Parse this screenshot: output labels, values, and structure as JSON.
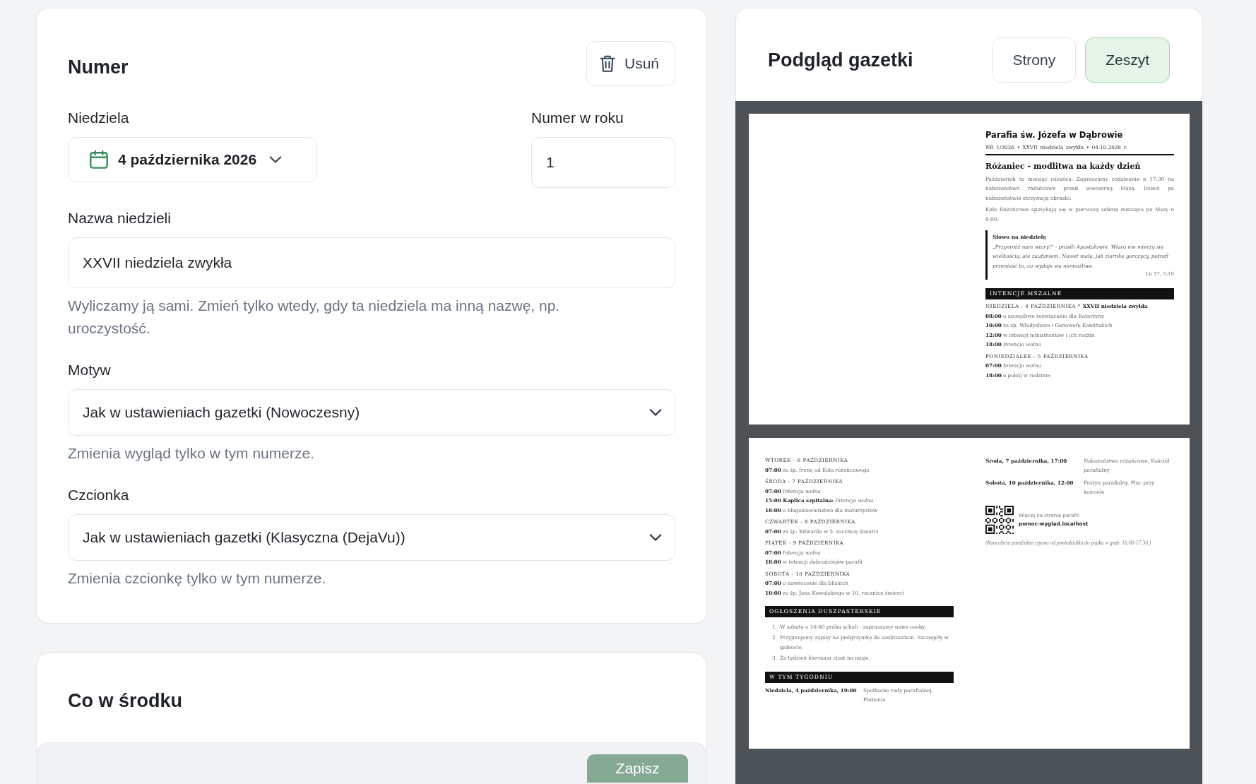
{
  "form": {
    "title": "Numer",
    "delete_button": "Usuń",
    "sunday": {
      "label": "Niedziela",
      "value": "4 października 2026"
    },
    "issue_number": {
      "label": "Numer w roku",
      "value": "1"
    },
    "sunday_name": {
      "label": "Nazwa niedzieli",
      "value": "XXVII niedziela zwykła",
      "hint": "Wyliczamy ją sami. Zmień tylko wtedy, gdy ta niedziela ma inną nazwę, np. uroczystość."
    },
    "theme": {
      "label": "Motyw",
      "value": "Jak w ustawieniach gazetki (Nowoczesny)",
      "hint": "Zmienia wygląd tylko w tym numerze."
    },
    "font": {
      "label": "Czcionka",
      "value": "Jak w ustawieniach gazetki (Klasyczna (DejaVu))",
      "hint": "Zmienia czcionkę tylko w tym numerze."
    }
  },
  "contents": {
    "title": "Co w środku"
  },
  "save_button": "Zapisz",
  "preview": {
    "title": "Podgląd gazetki",
    "modes": [
      {
        "label": "Strony",
        "selected": false
      },
      {
        "label": "Zeszyt",
        "selected": true
      }
    ],
    "sheets": [
      {
        "right": [
          {
            "kind": "masthead",
            "text": "Parafia św. Józefa w Dąbrowie"
          },
          {
            "kind": "meta",
            "text": "NR 1/2026 • XXVII niedziela zwykła • 04.10.2026 r."
          },
          {
            "kind": "heading",
            "text": "Różaniec - modlitwa na każdy dzień"
          },
          {
            "kind": "paragraph",
            "text": "Październik to miesiąc różańca. Zapraszamy codziennie o 17:30 na nabożeństwo różańcowe przed wieczorną Mszą. Dzieci po nabożeństwie otrzymają obrazki."
          },
          {
            "kind": "paragraph",
            "text": "Koła Różańcowe spotykają się w pierwszą sobotę miesiąca po Mszy o 8:00."
          },
          {
            "kind": "quote",
            "title": "Słowo na niedzielę",
            "text": "„Przymnóż nam wiary!” - prosili Apostołowie. Wiara nie mierzy się wielkością, ale zaufaniem. Nawet mała, jak ziarnko gorczycy, potrafi przenieść to, co wydaje się niemożliwe.",
            "source": "Łk 17, 5-10"
          },
          {
            "kind": "section",
            "text": "INTENCJE MSZALNE"
          },
          {
            "kind": "day",
            "text": "NIEDZIELA - 4 PAŹDZIERNIKA * **XXVII niedziela zwykła**"
          },
          {
            "kind": "mass",
            "text": "**08:00** o szczęśliwe rozwiązanie dla Katarzyny"
          },
          {
            "kind": "mass",
            "text": "**10:00** za śp. Władysława i Genowefę Kamińskich"
          },
          {
            "kind": "mass",
            "text": "**12:00** w intencji ministrantów i ich rodzin"
          },
          {
            "kind": "mass",
            "text": "**18:00** *Intencja wolna*"
          },
          {
            "kind": "day",
            "text": "PONIEDZIAŁEK - 5 PAŹDZIERNIKA"
          },
          {
            "kind": "mass",
            "text": "**07:00** *Intencja wolna*"
          },
          {
            "kind": "mass",
            "text": "**18:00** o pokój w rodzinie"
          }
        ]
      },
      {
        "left": [
          {
            "kind": "day",
            "text": "WTOREK - 6 PAŹDZIERNIKA"
          },
          {
            "kind": "mass",
            "text": "**07:00** za śp. Irenę od Koła różańcowego"
          },
          {
            "kind": "day",
            "text": "ŚRODA - 7 PAŹDZIERNIKA"
          },
          {
            "kind": "mass",
            "text": "**07:00** *Intencja wolna*"
          },
          {
            "kind": "mass",
            "text": "**15:00 Kaplica szpitalna:** *Intencja wolna*"
          },
          {
            "kind": "mass",
            "text": "**18:00** o błogosławieństwo dla maturzystów"
          },
          {
            "kind": "day",
            "text": "CZWARTEK - 8 PAŹDZIERNIKA"
          },
          {
            "kind": "mass",
            "text": "**07:00** za śp. Edwarda w 5. rocznicę śmierci"
          },
          {
            "kind": "day",
            "text": "PIĄTEK - 9 PAŹDZIERNIKA"
          },
          {
            "kind": "mass",
            "text": "**07:00** *Intencja wolna*"
          },
          {
            "kind": "mass",
            "text": "**18:00** w intencji dobrodziejów parafii"
          },
          {
            "kind": "day",
            "text": "SOBOTA - 10 PAŹDZIERNIKA"
          },
          {
            "kind": "mass",
            "text": "**07:00** o nawrócenie dla bliskich"
          },
          {
            "kind": "mass",
            "text": "**10:00** za śp. Jana Kowalskiego w 10. rocznicę śmierci"
          },
          {
            "kind": "section",
            "text": "OGŁOSZENIA DUSZPASTERSKIE"
          },
          {
            "kind": "list",
            "items": [
              {
                "number": "1.",
                "text": "W sobotę o 10:00 próba scholi - zapraszamy nowe osoby."
              },
              {
                "number": "2.",
                "text": "Przyjmujemy zapisy na pielgrzymkę do sanktuarium. Szczegóły w gablocie."
              },
              {
                "number": "3.",
                "text": "Za tydzień kiermasz ciast na misje."
              }
            ]
          },
          {
            "kind": "section",
            "text": "W TYM TYGODNIU"
          },
          {
            "kind": "event",
            "when": "Niedziela, 4 października, 19:00",
            "what": "Spotkanie rady parafialnej, Plebania"
          }
        ],
        "right": [
          {
            "kind": "event",
            "when": "Środa, 7 października, 17:00",
            "what": "Nabożeństwo różańcowe, Kościół parafialny"
          },
          {
            "kind": "event",
            "when": "Sobota, 10 października, 12:00",
            "what": "Festyn parafialny, Plac przy kościele"
          },
          {
            "kind": "qr",
            "label": "Więcej na stronie parafii:",
            "url": "pomoc-wyglad.localhost"
          },
          {
            "kind": "note",
            "text": "(Kancelaria parafialna czynna od poniedziałku do piątku w godz. 16:00-17:30.)"
          }
        ]
      }
    ]
  }
}
